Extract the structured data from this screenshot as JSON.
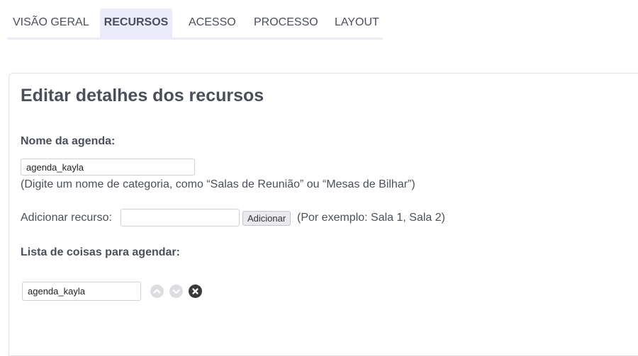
{
  "tabs": [
    {
      "label": "VISÃO GERAL",
      "active": false
    },
    {
      "label": "RECURSOS",
      "active": true
    },
    {
      "label": "ACESSO",
      "active": false
    },
    {
      "label": "PROCESSO",
      "active": false
    },
    {
      "label": "LAYOUT",
      "active": false
    }
  ],
  "panel": {
    "title": "Editar detalhes dos recursos",
    "schedule_name": {
      "label": "Nome da agenda:",
      "value": "agenda_kayla",
      "hint": "(Digite um nome de categoria, como “Salas de Reunião” ou “Mesas de Bilhar”)"
    },
    "add_resource": {
      "label": "Adicionar recurso:",
      "value": "",
      "button_label": "Adicionar",
      "example": "(Por exemplo: Sala 1, Sala 2)"
    },
    "resource_list": {
      "label": "Lista de coisas para agendar:",
      "items": [
        {
          "value": "agenda_kayla",
          "icons": [
            "chevron-up-icon",
            "chevron-down-icon",
            "remove-icon"
          ]
        }
      ]
    }
  },
  "colors": {
    "active_tab_bg": "#ecebfa",
    "tab_underline": "#ecebf7",
    "text": "#4a4f5a",
    "icon_disabled": "#dcdde0",
    "icon_remove": "#3a3a3a"
  }
}
